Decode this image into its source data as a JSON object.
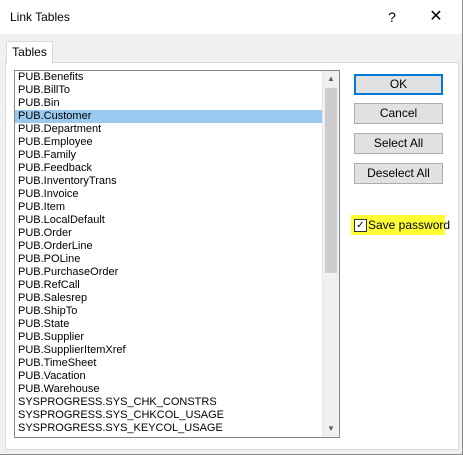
{
  "window": {
    "title": "Link Tables",
    "help_glyph": "?",
    "close_glyph": "✕"
  },
  "tabs": [
    {
      "label": "Tables"
    }
  ],
  "tables": [
    {
      "name": "PUB.Benefits",
      "selected": false
    },
    {
      "name": "PUB.BillTo",
      "selected": false
    },
    {
      "name": "PUB.Bin",
      "selected": false
    },
    {
      "name": "PUB.Customer",
      "selected": true
    },
    {
      "name": "PUB.Department",
      "selected": false
    },
    {
      "name": "PUB.Employee",
      "selected": false
    },
    {
      "name": "PUB.Family",
      "selected": false
    },
    {
      "name": "PUB.Feedback",
      "selected": false
    },
    {
      "name": "PUB.InventoryTrans",
      "selected": false
    },
    {
      "name": "PUB.Invoice",
      "selected": false
    },
    {
      "name": "PUB.Item",
      "selected": false
    },
    {
      "name": "PUB.LocalDefault",
      "selected": false
    },
    {
      "name": "PUB.Order",
      "selected": false
    },
    {
      "name": "PUB.OrderLine",
      "selected": false
    },
    {
      "name": "PUB.POLine",
      "selected": false
    },
    {
      "name": "PUB.PurchaseOrder",
      "selected": false
    },
    {
      "name": "PUB.RefCall",
      "selected": false
    },
    {
      "name": "PUB.Salesrep",
      "selected": false
    },
    {
      "name": "PUB.ShipTo",
      "selected": false
    },
    {
      "name": "PUB.State",
      "selected": false
    },
    {
      "name": "PUB.Supplier",
      "selected": false
    },
    {
      "name": "PUB.SupplierItemXref",
      "selected": false
    },
    {
      "name": "PUB.TimeSheet",
      "selected": false
    },
    {
      "name": "PUB.Vacation",
      "selected": false
    },
    {
      "name": "PUB.Warehouse",
      "selected": false
    },
    {
      "name": "SYSPROGRESS.SYS_CHK_CONSTRS",
      "selected": false
    },
    {
      "name": "SYSPROGRESS.SYS_CHKCOL_USAGE",
      "selected": false
    },
    {
      "name": "SYSPROGRESS.SYS_KEYCOL_USAGE",
      "selected": false
    }
  ],
  "scrollbar": {
    "up_glyph": "▲",
    "down_glyph": "▼"
  },
  "buttons": {
    "ok": "OK",
    "cancel": "Cancel",
    "select_all": "Select All",
    "deselect_all": "Deselect All"
  },
  "save_password": {
    "label": "Save password",
    "checked": true,
    "check_glyph": "✓"
  },
  "colors": {
    "selection": "#99c9ef",
    "highlight": "#ffff33",
    "default_button_border": "#0078d7"
  }
}
